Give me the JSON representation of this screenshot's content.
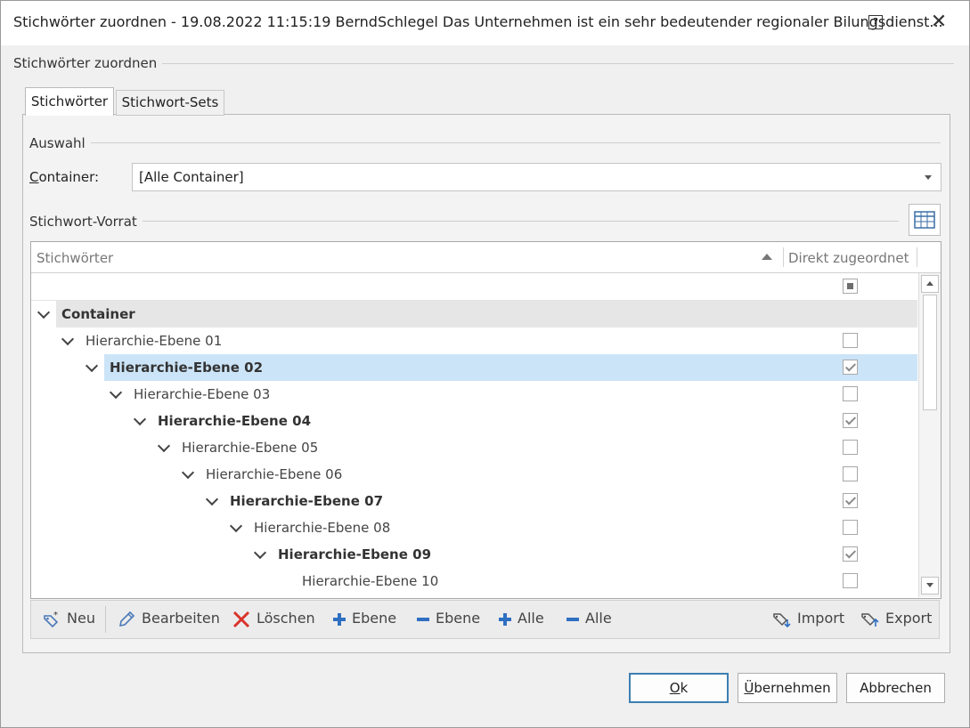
{
  "window": {
    "title": "Stichwörter zuordnen - 19.08.2022 11:15:19 BerndSchlegel Das Unternehmen ist ein sehr bedeutender regionaler Bilungsdienst...",
    "help_label": "?",
    "close_label": "✕"
  },
  "group": {
    "title": "Stichwörter zuordnen"
  },
  "tabs": [
    {
      "label": "Stichwörter",
      "active": true
    },
    {
      "label": "Stichwort-Sets",
      "active": false
    }
  ],
  "auswahl": {
    "title": "Auswahl",
    "container_label_prefix": "C",
    "container_label_rest": "ontainer:",
    "container_value": "[Alle Container]"
  },
  "vorrat": {
    "title": "Stichwort-Vorrat"
  },
  "tree": {
    "col_keywords": "Stichwörter",
    "col_assigned": "Direkt zugeordnet",
    "rows": [
      {
        "label": "Container",
        "level": 0,
        "bold": true,
        "expanded": true,
        "checked": null,
        "group_row": true
      },
      {
        "label": "Hierarchie-Ebene 01",
        "level": 1,
        "bold": false,
        "expanded": true,
        "checked": false
      },
      {
        "label": "Hierarchie-Ebene 02",
        "level": 2,
        "bold": true,
        "expanded": true,
        "checked": true,
        "selected": true
      },
      {
        "label": "Hierarchie-Ebene 03",
        "level": 3,
        "bold": false,
        "expanded": true,
        "checked": false
      },
      {
        "label": "Hierarchie-Ebene 04",
        "level": 4,
        "bold": true,
        "expanded": true,
        "checked": true
      },
      {
        "label": "Hierarchie-Ebene 05",
        "level": 5,
        "bold": false,
        "expanded": true,
        "checked": false
      },
      {
        "label": "Hierarchie-Ebene 06",
        "level": 6,
        "bold": false,
        "expanded": true,
        "checked": false
      },
      {
        "label": "Hierarchie-Ebene 07",
        "level": 7,
        "bold": true,
        "expanded": true,
        "checked": true
      },
      {
        "label": "Hierarchie-Ebene 08",
        "level": 8,
        "bold": false,
        "expanded": true,
        "checked": false
      },
      {
        "label": "Hierarchie-Ebene 09",
        "level": 9,
        "bold": true,
        "expanded": true,
        "checked": true
      },
      {
        "label": "Hierarchie-Ebene 10",
        "level": 10,
        "bold": false,
        "expanded": false,
        "checked": false
      }
    ]
  },
  "toolbar": {
    "new": "Neu",
    "edit": "Bearbeiten",
    "delete": "Löschen",
    "add_level": "Ebene",
    "remove_level": "Ebene",
    "add_all": "Alle",
    "remove_all": "Alle",
    "import": "Import",
    "export": "Export"
  },
  "buttons": {
    "ok_prefix": "O",
    "ok_rest": "k",
    "apply_prefix": "Ü",
    "apply_rest": "bernehmen",
    "cancel": "Abbrechen"
  },
  "colors": {
    "selection": "#cce4f7",
    "group_row": "#e6e6e6",
    "plus": "#2f6fc1",
    "delete": "#d9342b"
  }
}
